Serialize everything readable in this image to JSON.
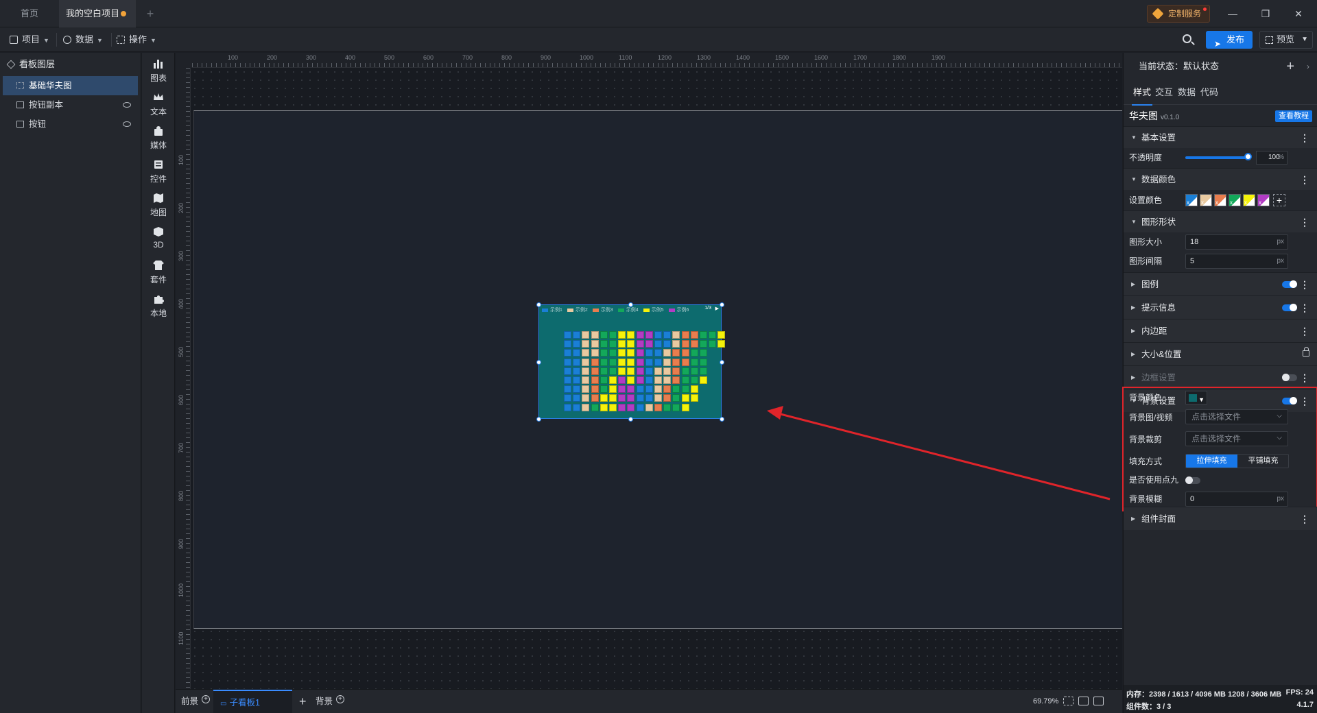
{
  "tabs": {
    "home": "首页",
    "project": "我的空白项目",
    "add": "+"
  },
  "titlebar": {
    "custom_service": "定制服务",
    "minimize": "—",
    "restore": "❐",
    "close": "✕"
  },
  "toolbar": {
    "menu_project": "项目",
    "menu_data": "数据",
    "menu_ops": "操作",
    "publish": "发布",
    "preview": "预览"
  },
  "layers": {
    "title": "看板图层",
    "items": [
      {
        "label": "基础华夫图"
      },
      {
        "label": "按钮副本"
      },
      {
        "label": "按钮"
      }
    ]
  },
  "components": [
    "图表",
    "文本",
    "媒体",
    "控件",
    "地图",
    "3D",
    "套件",
    "本地"
  ],
  "ruler": {
    "top": [
      "100",
      "200",
      "300",
      "400",
      "500",
      "600",
      "700",
      "800",
      "900",
      "1000",
      "1100",
      "1200",
      "1300",
      "1400",
      "1500",
      "1600",
      "1700",
      "1800",
      "1900"
    ],
    "left": [
      "100",
      "200",
      "300",
      "400",
      "500",
      "600",
      "700",
      "800",
      "900",
      "1000",
      "1100"
    ]
  },
  "widget": {
    "legend": [
      "示例1",
      "示例2",
      "示例3",
      "示例4",
      "示例5",
      "示例6"
    ],
    "legend_colors": [
      "#1a7fd6",
      "#e8c9a0",
      "#e87d4e",
      "#13a85a",
      "#f5f20a",
      "#b23cc4"
    ],
    "page": "1/3",
    "page_arrow": "▶",
    "background": "#0d6b6e",
    "grid_rows": [
      [
        0,
        0,
        1,
        1,
        3,
        3,
        4,
        4,
        5,
        5,
        0,
        0,
        1,
        2,
        2,
        3,
        3,
        4
      ],
      [
        0,
        0,
        1,
        1,
        3,
        3,
        4,
        4,
        5,
        5,
        0,
        0,
        1,
        2,
        2,
        3,
        3,
        4
      ],
      [
        0,
        0,
        1,
        1,
        3,
        3,
        4,
        4,
        5,
        0,
        0,
        1,
        2,
        2,
        3,
        3
      ],
      [
        0,
        0,
        1,
        2,
        3,
        3,
        4,
        4,
        5,
        0,
        0,
        1,
        2,
        2,
        3,
        3
      ],
      [
        0,
        0,
        1,
        2,
        3,
        3,
        4,
        4,
        5,
        0,
        1,
        1,
        2,
        3,
        3,
        3
      ],
      [
        0,
        0,
        1,
        2,
        3,
        4,
        5,
        4,
        5,
        0,
        1,
        1,
        2,
        3,
        3,
        4
      ],
      [
        0,
        0,
        1,
        2,
        3,
        4,
        5,
        5,
        0,
        0,
        1,
        2,
        3,
        3,
        4
      ],
      [
        0,
        0,
        1,
        2,
        4,
        4,
        5,
        5,
        0,
        0,
        1,
        2,
        3,
        4,
        4
      ],
      [
        0,
        0,
        1,
        3,
        4,
        4,
        5,
        5,
        0,
        1,
        2,
        3,
        3,
        4
      ]
    ]
  },
  "bottom": {
    "front": "前景",
    "sub_board": "子看板1",
    "add": "+",
    "background": "背景",
    "zoom": "69.79%"
  },
  "props": {
    "state": "当前状态：默认状态",
    "state_plus": "+",
    "state_more": "›",
    "tabs": [
      "样式",
      "交互",
      "数据",
      "代码"
    ],
    "component_name": "华夫图",
    "component_version": "v0.1.0",
    "tutorial": "查看教程",
    "sections": {
      "basic": "基本设置",
      "data_color": "数据颜色",
      "shape": "图形形状",
      "legend": "图例",
      "tooltip": "提示信息",
      "padding": "内边距",
      "size_pos": "大小&位置",
      "border": "边框设置",
      "background": "背景设置",
      "cover": "组件封面"
    },
    "opacity_label": "不透明度",
    "opacity_value": "100",
    "opacity_unit": "%",
    "opacity_level": 1.0,
    "set_color_label": "设置颜色",
    "swatches": [
      "#1a7fd6",
      "#e8c9a0",
      "#e87d4e",
      "#13a85a",
      "#f5f20a",
      "#b23cc4"
    ],
    "swatch_x": "x",
    "add_color": "+",
    "shape_size_label": "图形大小",
    "shape_size_value": "18",
    "shape_gap_label": "图形间隔",
    "shape_gap_value": "5",
    "unit_px": "px",
    "bg_color_label": "背景颜色",
    "bg_color": "#0d6b6e",
    "bg_image_label": "背景图/视频",
    "bg_image_placeholder": "点击选择文件",
    "bg_crop_label": "背景裁剪",
    "bg_crop_placeholder": "点击选择文件",
    "fill_label": "填充方式",
    "fill_stretch": "拉伸填充",
    "fill_tile": "平铺填充",
    "ninepatch_label": "是否使用点九",
    "blur_label": "背景模糊",
    "blur_value": "0"
  },
  "status": {
    "memory": "内存：2398 / 1613 / 4096 MB  1208 / 3606 MB",
    "fps": "FPS:  24",
    "count": "组件数：3 / 3",
    "version": "4.1.7"
  }
}
